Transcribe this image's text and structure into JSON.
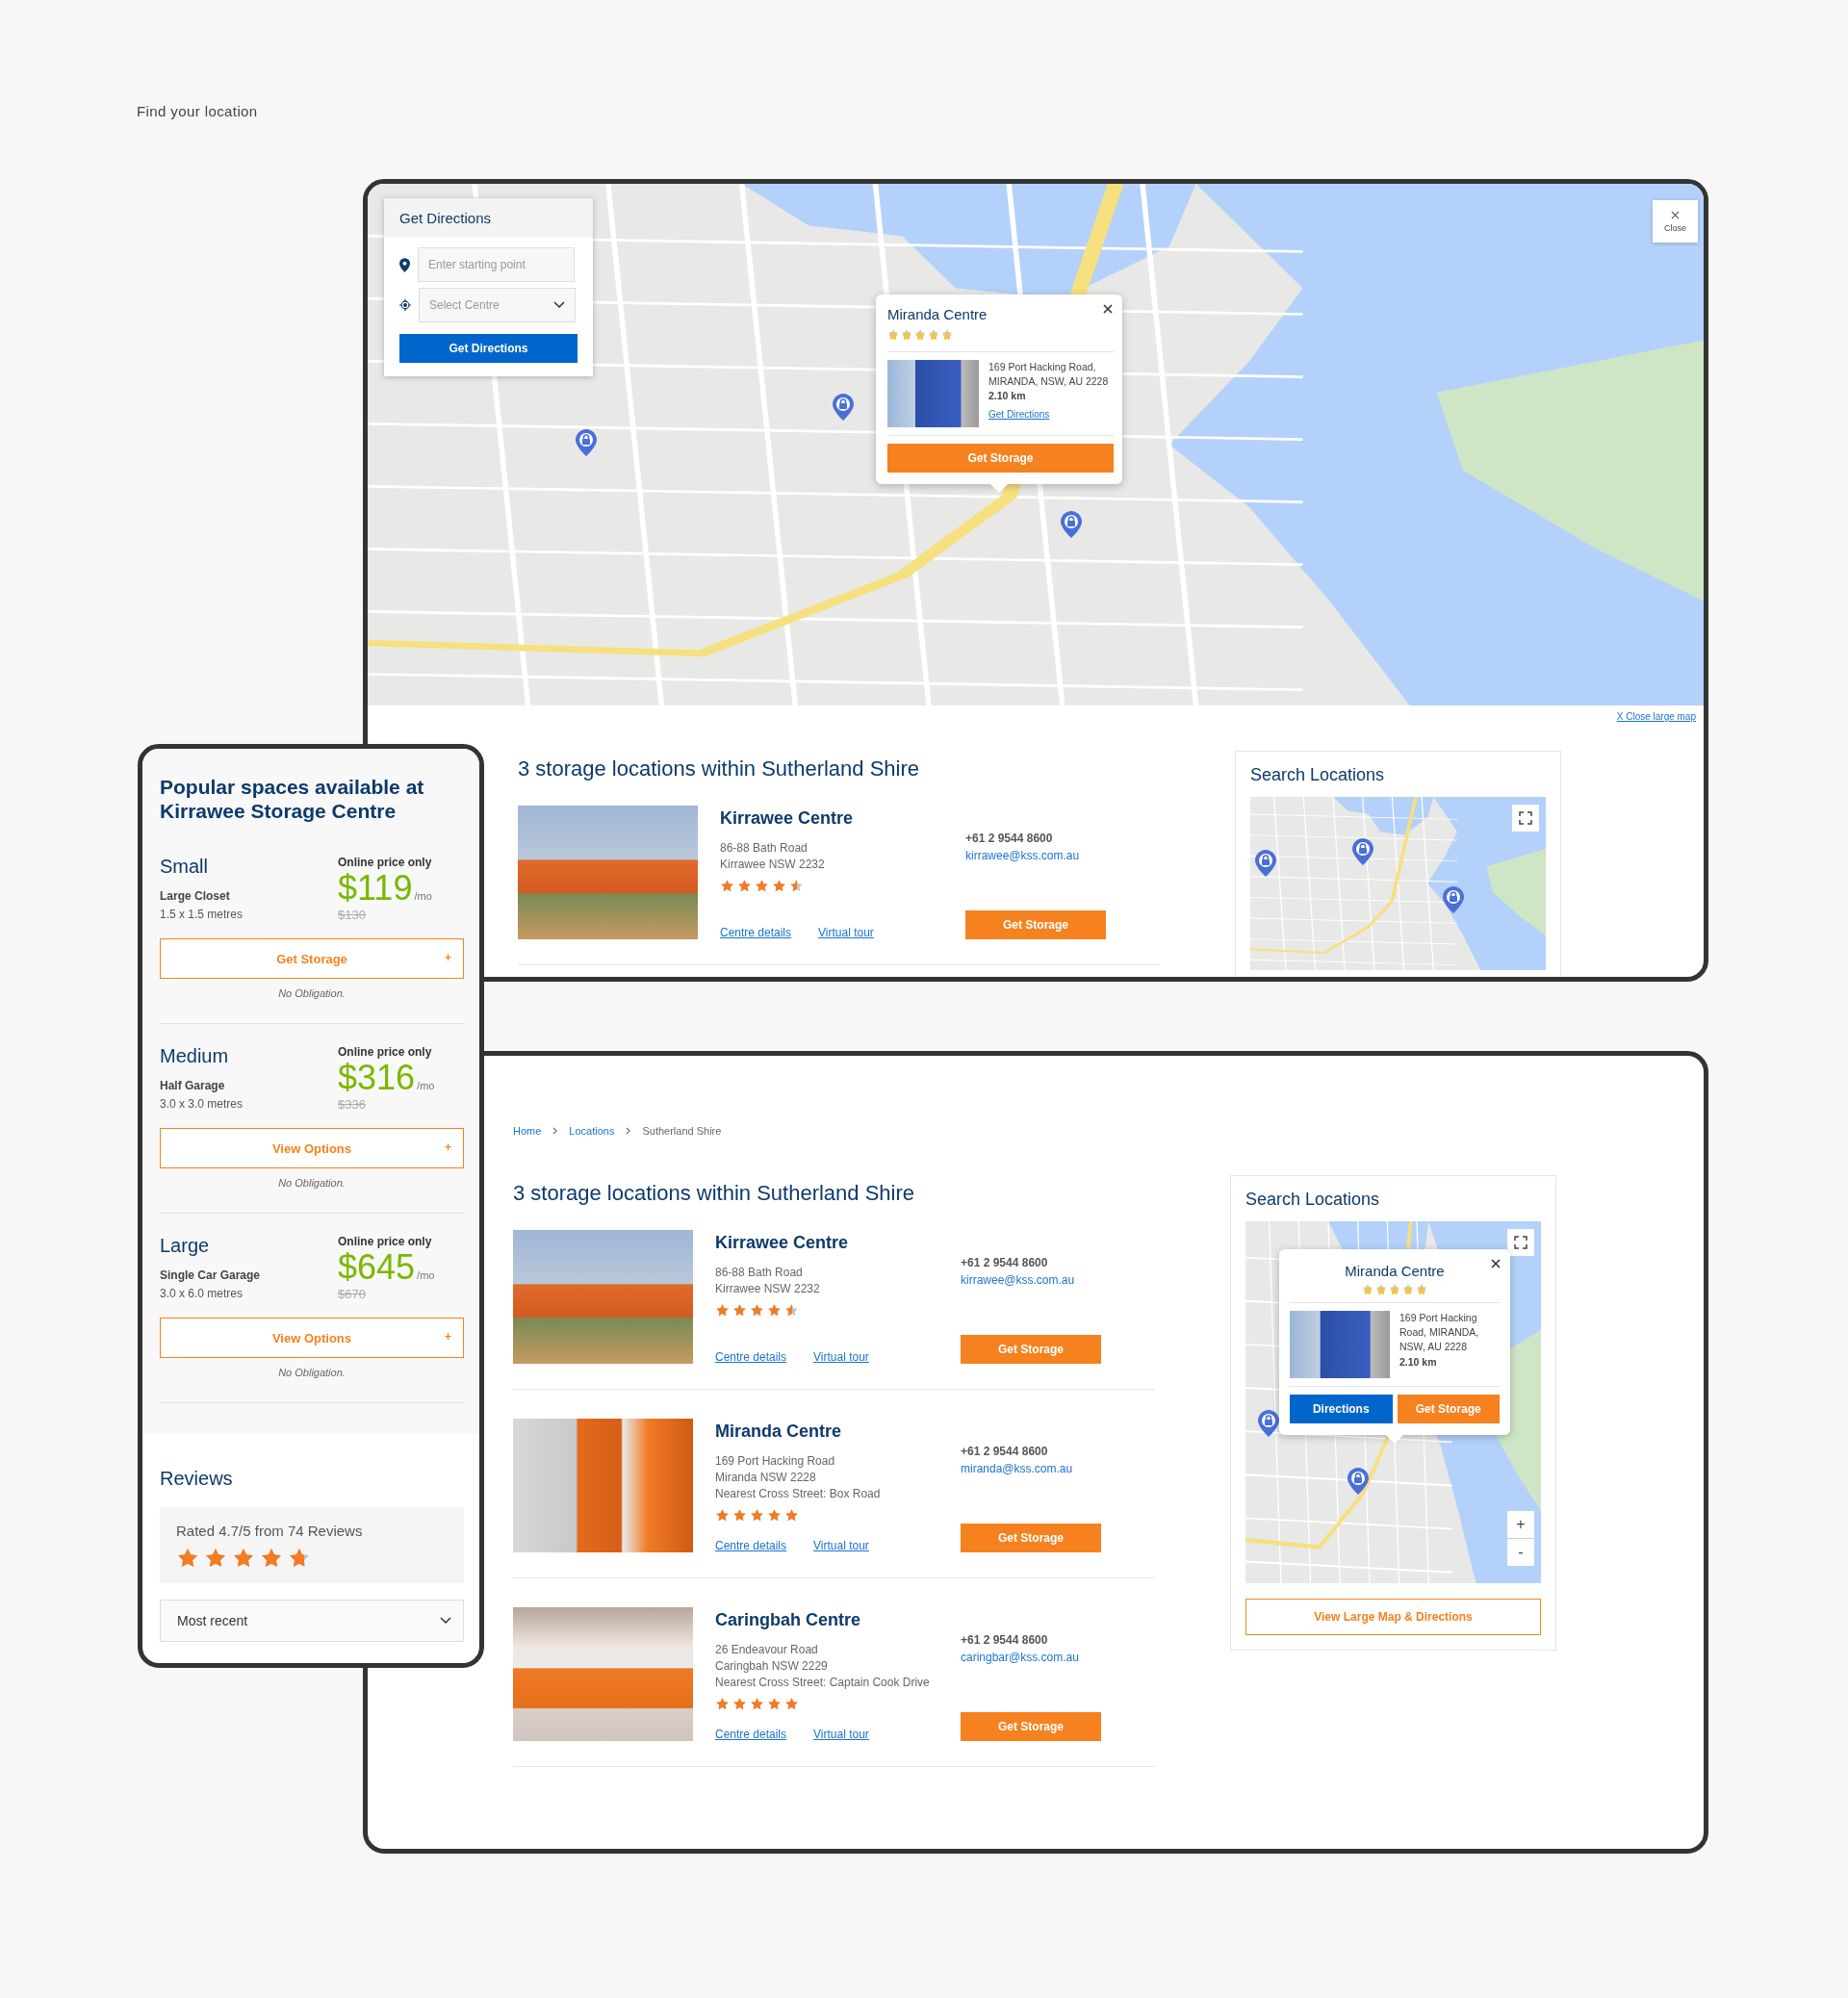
{
  "page_title": "Find your location",
  "large_map_screen": {
    "directions_panel": {
      "title": "Get Directions",
      "start_field": {
        "placeholder": "Enter starting point"
      },
      "centre_select": {
        "placeholder": "Select Centre"
      },
      "button": "Get Directions"
    },
    "close_button": "Close",
    "popup": {
      "title": "Miranda Centre",
      "stars": 5,
      "address": "169 Port Hacking Road, MIRANDA, NSW, AU 2228",
      "distance": "2.10 km",
      "link": "Get Directions",
      "button": "Get Storage"
    },
    "close_map_link": "X  Close large map",
    "heading": "3 storage locations within Sutherland Shire",
    "locations": [
      {
        "name": "Kirrawee Centre",
        "address_lines": [
          "86-88 Bath Road",
          "Kirrawee NSW 2232"
        ],
        "stars": 4.5,
        "phone": "+61 2 9544 8600",
        "email": "kirrawee@kss.com.au",
        "links": [
          "Centre details",
          "Virtual tour"
        ],
        "button": "Get Storage"
      }
    ],
    "sidebar": {
      "title": "Search Locations"
    }
  },
  "listing_screen": {
    "breadcrumb": [
      {
        "label": "Home",
        "kind": "link"
      },
      {
        "label": "Locations",
        "kind": "link"
      },
      {
        "label": "Sutherland Shire",
        "kind": "current"
      }
    ],
    "heading": "3 storage locations within Sutherland Shire",
    "locations": [
      {
        "name": "Kirrawee Centre",
        "address_lines": [
          "86-88 Bath Road",
          "Kirrawee NSW 2232"
        ],
        "stars": 4.5,
        "phone": "+61 2 9544 8600",
        "email": "kirrawee@kss.com.au",
        "links": [
          "Centre details",
          "Virtual tour"
        ],
        "button": "Get Storage"
      },
      {
        "name": "Miranda Centre",
        "address_lines": [
          "169 Port Hacking Road",
          "Miranda NSW 2228",
          "Nearest Cross Street: Box Road"
        ],
        "stars": 5,
        "phone": "+61 2 9544 8600",
        "email": "miranda@kss.com.au",
        "links": [
          "Centre details",
          "Virtual tour"
        ],
        "button": "Get Storage"
      },
      {
        "name": "Caringbah Centre",
        "address_lines": [
          "26 Endeavour Road",
          "Caringbah NSW 2229",
          "Nearest Cross Street: Captain Cook Drive"
        ],
        "stars": 5,
        "phone": "+61 2 9544 8600",
        "email": "caringbar@kss.com.au",
        "links": [
          "Centre details",
          "Virtual tour"
        ],
        "button": "Get Storage"
      }
    ],
    "sidebar": {
      "title": "Search Locations",
      "popup": {
        "title": "Miranda Centre",
        "stars": 5,
        "address": "169 Port Hacking Road, MIRANDA, NSW, AU 2228",
        "distance": "2.10 km",
        "buttons": [
          "Directions",
          "Get Storage"
        ]
      },
      "zoom_in": "+",
      "zoom_out": "-",
      "button": "View Large Map & Directions"
    }
  },
  "mobile_screen": {
    "title": "Popular spaces available at Kirrawee Storage Centre",
    "spaces": [
      {
        "size": "Small",
        "type": "Large Closet",
        "dimensions": "1.5 x 1.5 metres",
        "price_label": "Online price only",
        "price": "$119",
        "unit": "/mo",
        "old_price": "$130",
        "button": "Get Storage",
        "button_icon": "+",
        "note": "No Obligation."
      },
      {
        "size": "Medium",
        "type": "Half Garage",
        "dimensions": "3.0 x 3.0 metres",
        "price_label": "Online price only",
        "price": "$316",
        "unit": "/mo",
        "old_price": "$336",
        "button": "View Options",
        "button_icon": "+",
        "note": "No Obligation."
      },
      {
        "size": "Large",
        "type": "Single Car Garage",
        "dimensions": "3.0 x 6.0 metres",
        "price_label": "Online price only",
        "price": "$645",
        "unit": "/mo",
        "old_price": "$670",
        "button": "View Options",
        "button_icon": "+",
        "note": "No Obligation."
      }
    ],
    "reviews": {
      "title": "Reviews",
      "summary": "Rated 4.7/5 from 74 Reviews",
      "stars": 4.7,
      "sort": "Most recent"
    }
  }
}
